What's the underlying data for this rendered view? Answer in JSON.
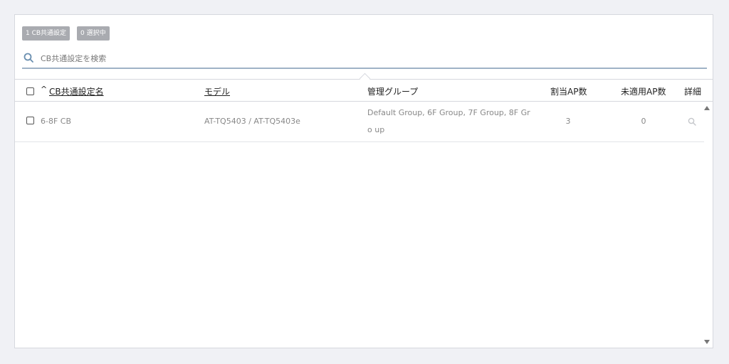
{
  "badges": {
    "count_label": "1 CB共通設定",
    "selected_label": "0 選択中"
  },
  "search": {
    "placeholder": "CB共通設定を検索",
    "value": ""
  },
  "table": {
    "columns": {
      "name": "CB共通設定名",
      "model": "モデル",
      "group": "管理グループ",
      "assigned_ap": "割当AP数",
      "unapplied_ap": "未適用AP数",
      "detail": "詳細"
    },
    "sort_indicator": "^",
    "rows": [
      {
        "name": "6-8F CB",
        "model": "AT-TQ5403 / AT-TQ5403e",
        "group": "Default Group, 6F Group, 7F Group, 8F Gro up",
        "assigned_ap": "3",
        "unapplied_ap": "0",
        "detail_icon": "search-icon"
      }
    ]
  },
  "colors": {
    "badge_bg": "#a9abb0",
    "search_underline": "#9fb2c6",
    "page_bg": "#f0f1f5"
  }
}
